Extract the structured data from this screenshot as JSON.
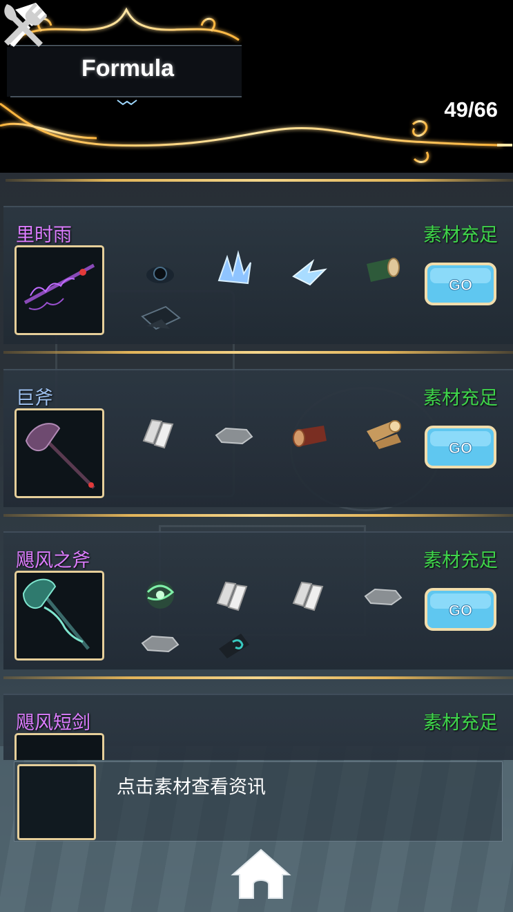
{
  "header": {
    "title": "Formula",
    "count": "49/66",
    "icons": [
      "hammer-icon",
      "utensils-icon"
    ]
  },
  "recipes": [
    {
      "name": "里时雨",
      "rarity_color": "#dd7dff",
      "status": "素材充足",
      "item_icon": "dark-spear-icon",
      "materials": [
        "dark-ore-icon",
        "ice-crystal-cluster-icon",
        "ice-shard-icon",
        "green-log-icon",
        "dark-ingot-icon"
      ],
      "go_label": "GO"
    },
    {
      "name": "巨斧",
      "rarity_color": "#9fc2f2",
      "status": "素材充足",
      "item_icon": "great-axe-icon",
      "materials": [
        "silver-ingot-icon",
        "stone-slab-icon",
        "red-log-icon",
        "wood-logs-icon"
      ],
      "go_label": "GO"
    },
    {
      "name": "飓风之斧",
      "rarity_color": "#dd7dff",
      "status": "素材充足",
      "item_icon": "storm-axe-icon",
      "materials": [
        "wind-orb-icon",
        "silver-ingot-icon",
        "silver-ingot-icon",
        "stone-slab-icon",
        "stone-slab-icon",
        "dark-scroll-icon"
      ],
      "go_label": "GO"
    },
    {
      "name": "飓风短剑",
      "rarity_color": "#dd7dff",
      "status": "素材充足"
    }
  ],
  "info_panel": {
    "hint": "点击素材查看资讯"
  },
  "footer": {
    "home_icon": "home-icon"
  }
}
